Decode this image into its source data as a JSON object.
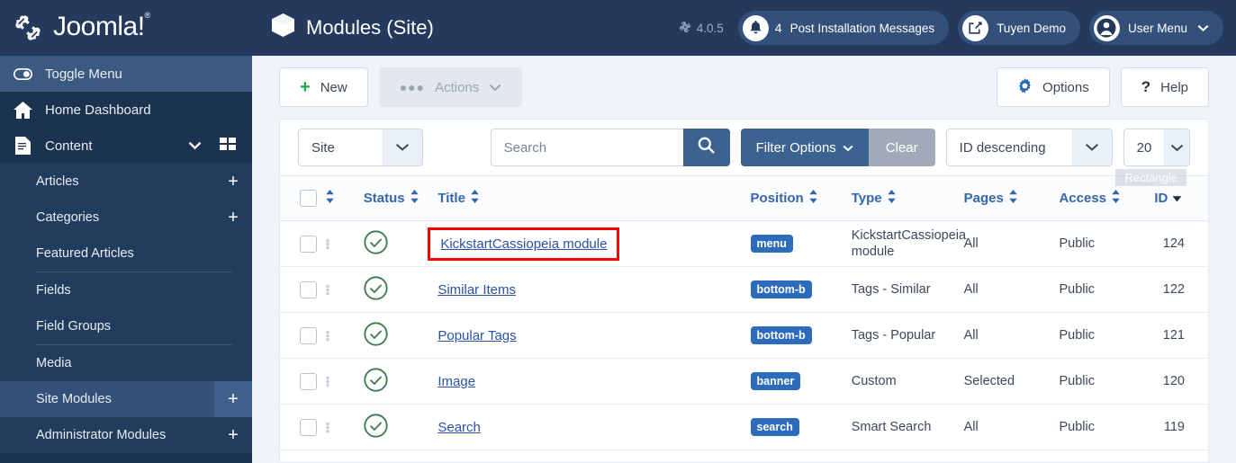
{
  "brand": {
    "name": "Joomla!",
    "trademark": "®",
    "logo_icon": "joomla-logo-icon"
  },
  "sidebar": {
    "toggle": {
      "label": "Toggle Menu",
      "icon": "toggle-menu-icon"
    },
    "items": [
      {
        "label": "Home Dashboard",
        "icon": "home-icon"
      },
      {
        "label": "Content",
        "icon": "document-icon",
        "chevron": "chevron-down-icon",
        "grid": "grid-icon"
      }
    ],
    "submenu": [
      {
        "label": "Articles",
        "plus": "+"
      },
      {
        "label": "Categories",
        "plus": "+"
      },
      {
        "label": "Featured Articles",
        "plus": ""
      },
      {
        "label": "Fields",
        "plus": ""
      },
      {
        "label": "Field Groups",
        "plus": ""
      },
      {
        "label": "Media",
        "plus": ""
      },
      {
        "label": "Site Modules",
        "plus": "+",
        "active": true
      },
      {
        "label": "Administrator Modules",
        "plus": "+"
      }
    ]
  },
  "header": {
    "title": "Modules (Site)",
    "title_icon": "box-icon",
    "version": "4.0.5",
    "version_icon": "joomla-mark-icon",
    "messages": {
      "label": "Post Installation Messages",
      "count": "4",
      "icon": "bell-icon"
    },
    "site": {
      "label": "Tuyen Demo",
      "icon": "external-link-icon"
    },
    "user": {
      "label": "User Menu",
      "icon": "user-circle-icon",
      "chevron": "chevron-down-icon"
    }
  },
  "toolbar": {
    "new_label": "New",
    "new_icon": "plus-icon",
    "actions_label": "Actions",
    "actions_icon": "ellipsis-icon",
    "actions_chevron": "chevron-down-icon",
    "options_label": "Options",
    "options_icon": "gear-icon",
    "help_label": "Help",
    "help_icon": "question-mark-icon"
  },
  "filters": {
    "scope_value": "Site",
    "search_placeholder": "Search",
    "search_icon": "search-icon",
    "search_button_icon": "search-icon",
    "filter_options_label": "Filter Options",
    "filter_options_chevron": "chevron-down-icon",
    "clear_label": "Clear",
    "ordering_value": "ID descending",
    "limit_value": "20",
    "tooltip": "Rectangle"
  },
  "table": {
    "headers": {
      "checkbox": "",
      "ordering": "",
      "status": "Status",
      "title": "Title",
      "position": "Position",
      "type": "Type",
      "pages": "Pages",
      "access": "Access",
      "id": "ID"
    },
    "rows": [
      {
        "status_icon": "check-circle-icon",
        "title": "KickstartCassiopeia module",
        "highlighted": true,
        "position": "menu",
        "type": "KickstartCassiopeia module",
        "pages": "All",
        "access": "Public",
        "id": "124"
      },
      {
        "status_icon": "check-circle-icon",
        "title": "Similar Items",
        "highlighted": false,
        "position": "bottom-b",
        "type": "Tags - Similar",
        "pages": "All",
        "access": "Public",
        "id": "122"
      },
      {
        "status_icon": "check-circle-icon",
        "title": "Popular Tags",
        "highlighted": false,
        "position": "bottom-b",
        "type": "Tags - Popular",
        "pages": "All",
        "access": "Public",
        "id": "121"
      },
      {
        "status_icon": "check-circle-icon",
        "title": "Image",
        "highlighted": false,
        "position": "banner",
        "type": "Custom",
        "pages": "Selected",
        "access": "Public",
        "id": "120"
      },
      {
        "status_icon": "check-circle-icon",
        "title": "Search",
        "highlighted": false,
        "position": "search",
        "type": "Smart Search",
        "pages": "All",
        "access": "Public",
        "id": "119"
      }
    ]
  },
  "colors": {
    "sidebar_bg": "#1c3350",
    "header_bg": "#24395b",
    "accent_blue": "#3c6292",
    "link_blue": "#2a52a5",
    "badge_blue": "#2d6bbd",
    "status_green": "#3c7a4b",
    "highlight_red": "#ff0000",
    "page_bg": "#f0f4f9"
  }
}
